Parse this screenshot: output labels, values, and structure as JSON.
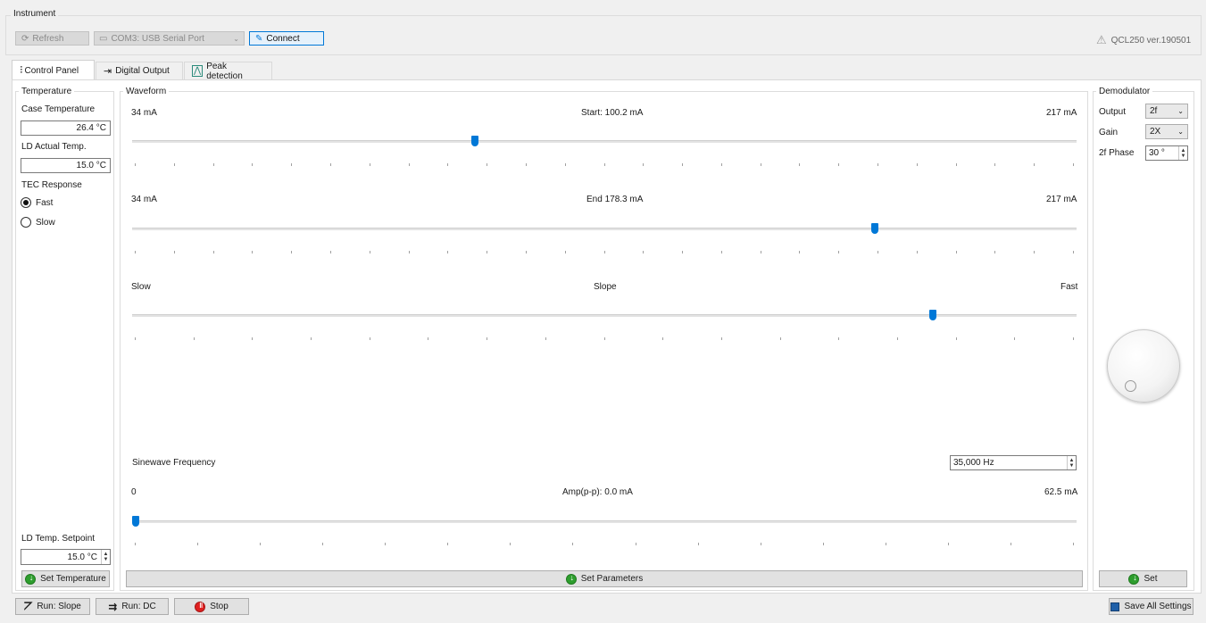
{
  "instrument": {
    "group_title": "Instrument",
    "refresh_label": "Refresh",
    "port_value": "COM3: USB Serial Port",
    "connect_label": "Connect",
    "version": "QCL250 ver.190501"
  },
  "tabs": [
    {
      "label": "Control Panel",
      "icon": "sliders-icon",
      "active": true
    },
    {
      "label": "Digital Output",
      "icon": "digital-output-icon",
      "active": false
    },
    {
      "label": "Peak detection",
      "icon": "peak-icon",
      "active": false
    }
  ],
  "temperature": {
    "group_title": "Temperature",
    "case_label": "Case Temperature",
    "case_value": "26.4 °C",
    "ld_actual_label": "LD Actual Temp.",
    "ld_actual_value": "15.0 °C",
    "tec_label": "TEC Response",
    "fast_label": "Fast",
    "slow_label": "Slow",
    "tec_selected": "Fast",
    "setpoint_label": "LD Temp. Setpoint",
    "setpoint_value": "15.0 °C",
    "set_button": "Set Temperature"
  },
  "waveform": {
    "group_title": "Waveform",
    "start": {
      "min_label": "34 mA",
      "center_label": "Start:  100.2 mA",
      "max_label": "217 mA",
      "min": 34,
      "max": 217,
      "value": 100.2
    },
    "end": {
      "min_label": "34 mA",
      "center_label": "End  178.3 mA",
      "max_label": "217 mA",
      "min": 34,
      "max": 217,
      "value": 178.3
    },
    "slope": {
      "min_label": "Slow",
      "center_label": "Slope",
      "max_label": "Fast",
      "fraction": 0.85
    },
    "sinewave_label": "Sinewave Frequency",
    "sinewave_value": "35,000 Hz",
    "amp": {
      "min_label": "0",
      "center_label": "Amp(p-p):  0.0 mA",
      "max_label": "62.5 mA",
      "min": 0,
      "max": 62.5,
      "value": 0.0
    },
    "set_button": "Set Parameters"
  },
  "demodulator": {
    "group_title": "Demodulator",
    "output_label": "Output",
    "output_value": "2f",
    "gain_label": "Gain",
    "gain_value": "2X",
    "phase_label": "2f Phase",
    "phase_value": "30 °",
    "set_button": "Set"
  },
  "bottom": {
    "run_slope": "Run: Slope",
    "run_dc": "Run: DC",
    "stop": "Stop",
    "save_all": "Save All Settings"
  },
  "colors": {
    "accent": "#0078d7",
    "go_green": "#2e9e2e",
    "stop_red": "#e02020"
  }
}
